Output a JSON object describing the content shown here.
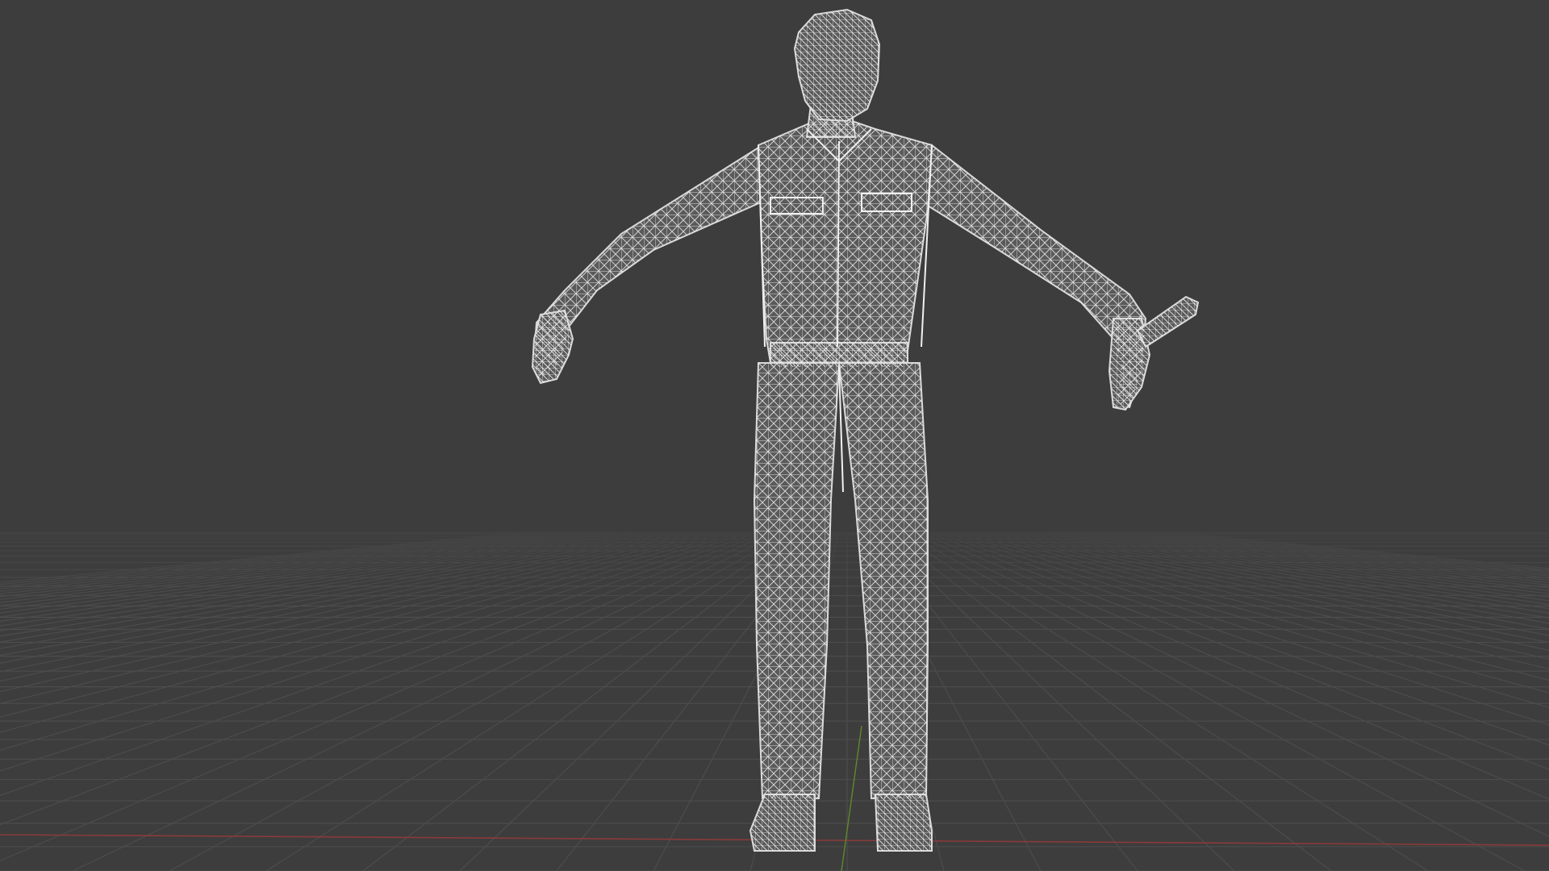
{
  "viewport": {
    "background_color": "#3d3d3d",
    "grid_color": "#4c4c4c",
    "x_axis_color": "#8a3a3a",
    "y_axis_color": "#5d8a2a",
    "mesh_wire_color": "#d9d9d9",
    "mesh_fill_color": "#8f8f8f"
  },
  "scene": {
    "object": "humanoid-character-mesh",
    "display_mode": "wireframe",
    "pose": "a-pose",
    "held_item": "flashlight"
  }
}
